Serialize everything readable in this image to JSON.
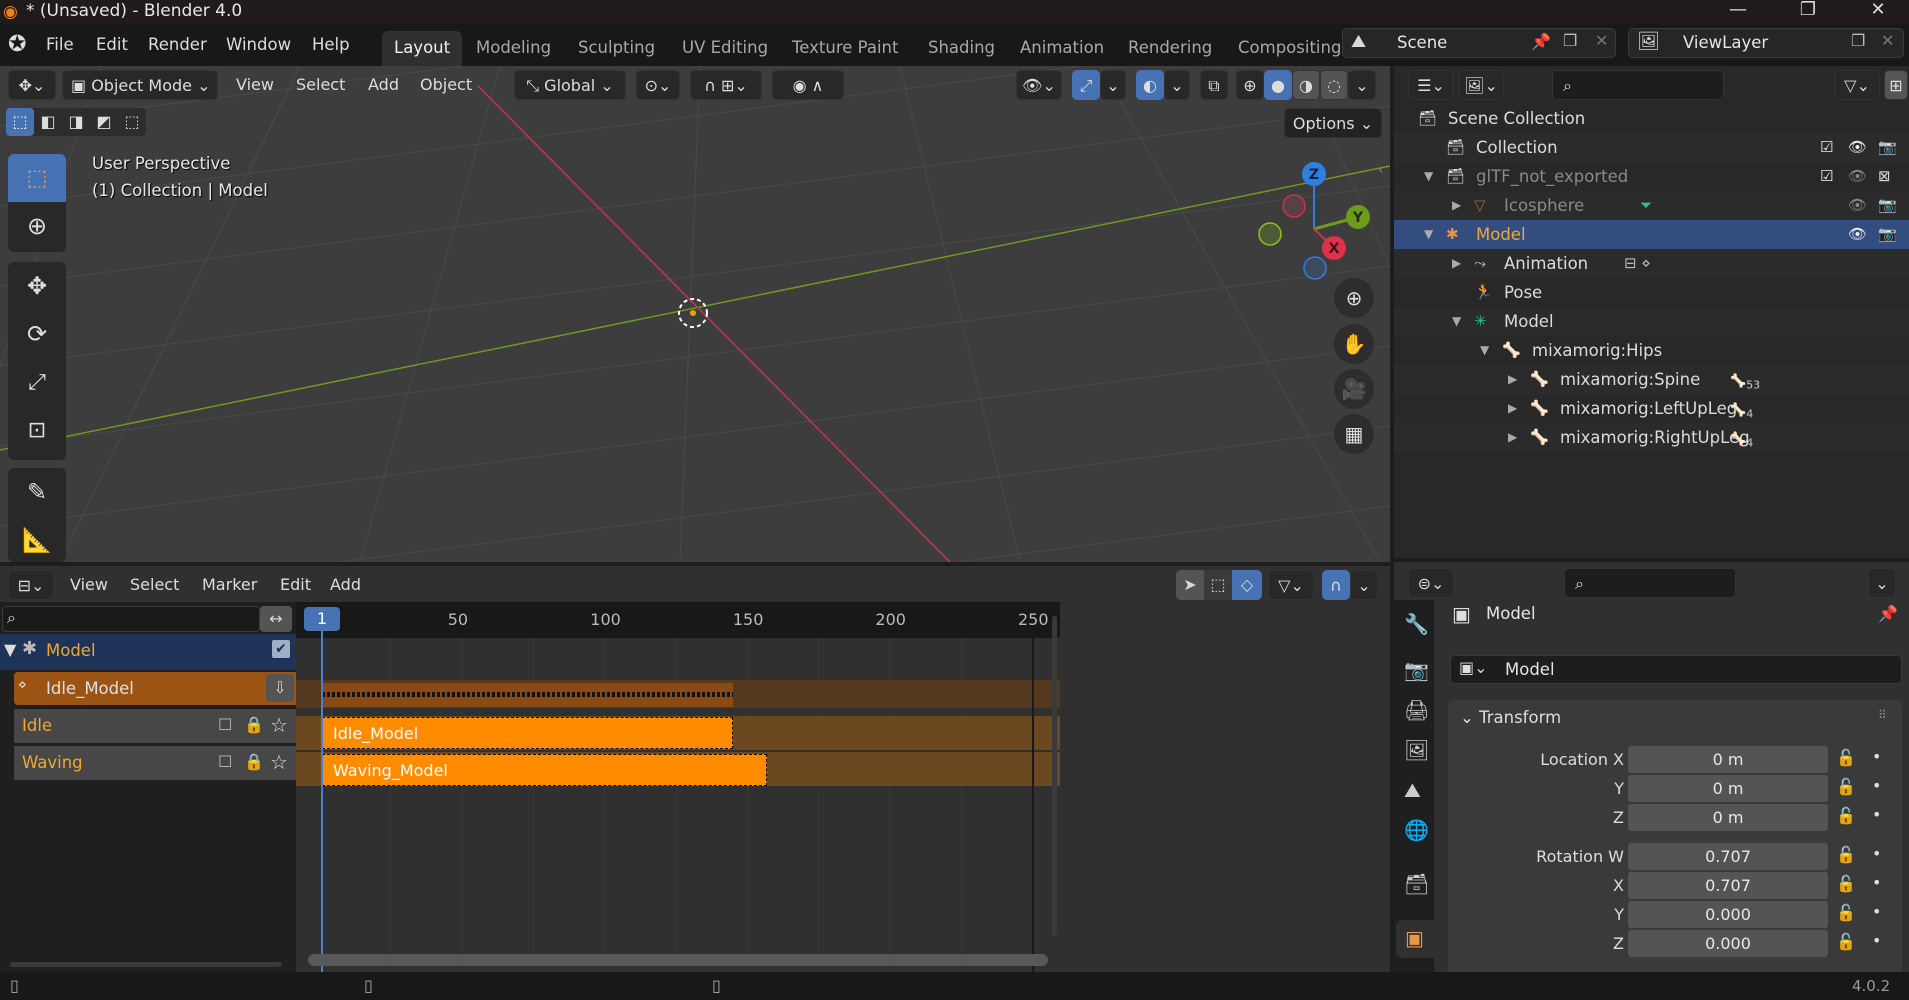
{
  "window": {
    "title": "* (Unsaved) - Blender 4.0",
    "controls": {
      "minimize": "—",
      "maximize": "❐",
      "close": "✕"
    }
  },
  "menubar": {
    "items": [
      "File",
      "Edit",
      "Render",
      "Window",
      "Help"
    ],
    "workspace_tabs": [
      "Layout",
      "Modeling",
      "Sculpting",
      "UV Editing",
      "Texture Paint",
      "Shading",
      "Animation",
      "Rendering",
      "Compositing"
    ],
    "active_tab": "Layout",
    "scene": "Scene",
    "view_layer": "ViewLayer"
  },
  "viewport": {
    "mode": "Object Mode",
    "menus": [
      "View",
      "Select",
      "Add",
      "Object"
    ],
    "transform_orientation": "Global",
    "options_label": "Options",
    "perspective_label": "User Perspective",
    "context_label": "(1) Collection | Model",
    "gizmo": {
      "z": "Z",
      "y": "Y",
      "x": "X"
    },
    "colors": {
      "x_axis": "#c7354a",
      "y_axis": "#6e9a1e",
      "z_axis": "#2f7fe0",
      "accent": "#4772b3"
    }
  },
  "outliner": {
    "rows": [
      {
        "label": "Scene Collection",
        "icon": "collection-icon",
        "depth": 0
      },
      {
        "label": "Collection",
        "icon": "collection-icon",
        "depth": 1,
        "checked": true
      },
      {
        "label": "glTF_not_exported",
        "icon": "collection-icon",
        "depth": 1,
        "checked": true,
        "dimmed": true,
        "expanded": true
      },
      {
        "label": "Icosphere",
        "icon": "mesh-icon",
        "depth": 2,
        "dimmed": true
      },
      {
        "label": "Model",
        "icon": "armature-icon",
        "depth": 1,
        "selected": true,
        "expanded": true
      },
      {
        "label": "Animation",
        "icon": "animation-icon",
        "depth": 2
      },
      {
        "label": "Pose",
        "icon": "pose-icon",
        "depth": 2
      },
      {
        "label": "Model",
        "icon": "armature-data-icon",
        "depth": 2,
        "expanded": true
      },
      {
        "label": "mixamorig:Hips",
        "icon": "bone-icon",
        "depth": 3,
        "expanded": true
      },
      {
        "label": "mixamorig:Spine",
        "icon": "bone-icon",
        "depth": 4,
        "child_count": "53"
      },
      {
        "label": "mixamorig:LeftUpLeg",
        "icon": "bone-icon",
        "depth": 4,
        "child_count": "4"
      },
      {
        "label": "mixamorig:RightUpLeg",
        "icon": "bone-icon",
        "depth": 4,
        "child_count": "4"
      }
    ]
  },
  "properties": {
    "object_name": "Model",
    "datablock_name": "Model",
    "panel_title": "Transform",
    "location": [
      {
        "label": "Location X",
        "value": "0 m"
      },
      {
        "label": "Y",
        "value": "0 m"
      },
      {
        "label": "Z",
        "value": "0 m"
      }
    ],
    "rotation": [
      {
        "label": "Rotation W",
        "value": "0.707"
      },
      {
        "label": "X",
        "value": "0.707"
      },
      {
        "label": "Y",
        "value": "0.000"
      },
      {
        "label": "Z",
        "value": "0.000"
      }
    ]
  },
  "nla": {
    "menus": [
      "View",
      "Select",
      "Marker",
      "Edit",
      "Add"
    ],
    "current_frame": "1",
    "ruler_ticks": [
      "50",
      "100",
      "150",
      "200",
      "250"
    ],
    "channels": {
      "object": "Model",
      "action": "Idle_Model",
      "tracks": [
        "Idle",
        "Waving"
      ]
    },
    "strips": [
      {
        "track": "Idle",
        "label": "Idle_Model",
        "start": 1,
        "end": 145
      },
      {
        "track": "Waving",
        "label": "Waving_Model",
        "start": 1,
        "end": 157
      }
    ],
    "action_range": {
      "start": 1,
      "end": 145
    }
  },
  "statusbar": {
    "version": "4.0.2"
  }
}
